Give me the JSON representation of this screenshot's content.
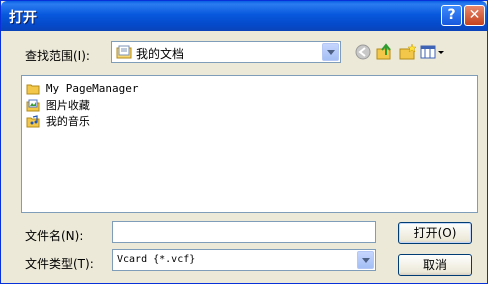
{
  "window": {
    "title": "打开"
  },
  "title_buttons": {
    "help": "?",
    "close": "✕"
  },
  "lookin": {
    "label": "查找范围(I):",
    "value": "我的文档"
  },
  "toolbar": {
    "icons": [
      "back-icon",
      "up-folder-icon",
      "new-folder-icon",
      "view-menu-icon"
    ]
  },
  "files": [
    {
      "name": "My PageManager",
      "icon": "folder-icon"
    },
    {
      "name": "图片收藏",
      "icon": "pictures-folder-icon"
    },
    {
      "name": "我的音乐",
      "icon": "music-folder-icon"
    }
  ],
  "filename": {
    "label": "文件名(N):",
    "value": ""
  },
  "filetype": {
    "label": "文件类型(T):",
    "value": "Vcard {*.vcf}"
  },
  "buttons": {
    "open": "打开(O)",
    "cancel": "取消"
  },
  "colors": {
    "titlebar": "#0858dd",
    "dialog_bg": "#ece9d8",
    "field_border": "#7f9db9"
  }
}
